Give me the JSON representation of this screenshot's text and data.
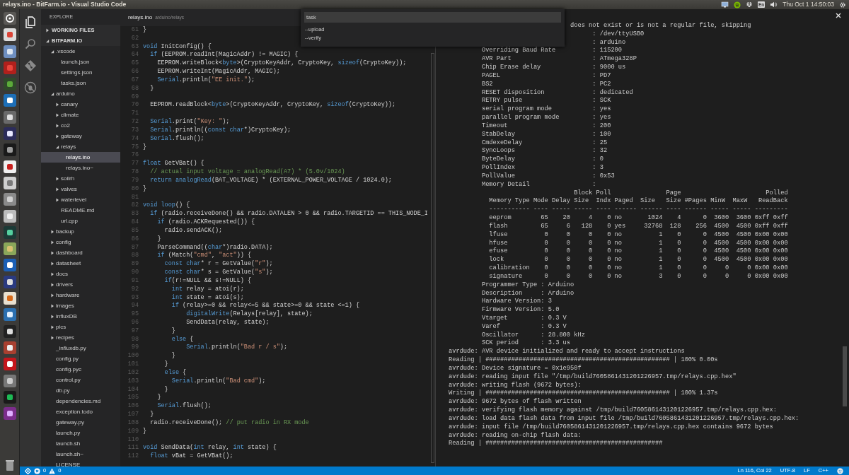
{
  "top_bar": {
    "title": "relays.ino - BitFarm.io - Visual Studio Code",
    "keyboard_layout": "En",
    "clock": "Thu Oct 1 14:50:03"
  },
  "activity_bar": [
    {
      "kind": "files",
      "selected": true
    },
    {
      "kind": "search",
      "selected": false
    },
    {
      "kind": "git",
      "selected": false
    },
    {
      "kind": "debug",
      "selected": false
    }
  ],
  "explorer": {
    "title": "EXPLORE",
    "sections": [
      {
        "label": "WORKING FILES",
        "expanded": false
      },
      {
        "label": "BITFARM.IO",
        "expanded": true,
        "children": [
          {
            "label": ".vscode",
            "kind": "folder",
            "expanded": true,
            "selected": false,
            "children": [
              {
                "label": "launch.json",
                "kind": "file",
                "selected": false
              },
              {
                "label": "settings.json",
                "kind": "file",
                "selected": false
              },
              {
                "label": "tasks.json",
                "kind": "file",
                "selected": false
              }
            ]
          },
          {
            "label": "arduino",
            "kind": "folder",
            "expanded": true,
            "selected": false,
            "children": [
              {
                "label": "canary",
                "kind": "folder",
                "expanded": false,
                "selected": false
              },
              {
                "label": "climate",
                "kind": "folder",
                "expanded": false,
                "selected": false
              },
              {
                "label": "co2",
                "kind": "folder",
                "expanded": false,
                "selected": false
              },
              {
                "label": "gateway",
                "kind": "folder",
                "expanded": false,
                "selected": false
              },
              {
                "label": "relays",
                "kind": "folder",
                "expanded": true,
                "selected": false,
                "children": [
                  {
                    "label": "relays.ino",
                    "kind": "file",
                    "selected": true
                  },
                  {
                    "label": "relays.ino~",
                    "kind": "file",
                    "selected": false
                  }
                ]
              },
              {
                "label": "soilrh",
                "kind": "folder",
                "expanded": false,
                "selected": false
              },
              {
                "label": "valves",
                "kind": "folder",
                "expanded": false,
                "selected": false
              },
              {
                "label": "waterlevel",
                "kind": "folder",
                "expanded": false,
                "selected": false
              },
              {
                "label": "README.md",
                "kind": "file",
                "selected": false
              },
              {
                "label": "url.cpp",
                "kind": "file",
                "selected": false
              }
            ]
          },
          {
            "label": "backup",
            "kind": "folder",
            "expanded": false,
            "selected": false
          },
          {
            "label": "config",
            "kind": "folder",
            "expanded": false,
            "selected": false
          },
          {
            "label": "dashboard",
            "kind": "folder",
            "expanded": false,
            "selected": false
          },
          {
            "label": "datasheet",
            "kind": "folder",
            "expanded": false,
            "selected": false
          },
          {
            "label": "docs",
            "kind": "folder",
            "expanded": false,
            "selected": false
          },
          {
            "label": "drivers",
            "kind": "folder",
            "expanded": false,
            "selected": false
          },
          {
            "label": "hardware",
            "kind": "folder",
            "expanded": false,
            "selected": false
          },
          {
            "label": "images",
            "kind": "folder",
            "expanded": false,
            "selected": false
          },
          {
            "label": "influxDB",
            "kind": "folder",
            "expanded": false,
            "selected": false
          },
          {
            "label": "pics",
            "kind": "folder",
            "expanded": false,
            "selected": false
          },
          {
            "label": "recipes",
            "kind": "folder",
            "expanded": false,
            "selected": false
          },
          {
            "label": "_influxdb.py",
            "kind": "file",
            "selected": false
          },
          {
            "label": "config.py",
            "kind": "file",
            "selected": false
          },
          {
            "label": "config.pyc",
            "kind": "file",
            "selected": false
          },
          {
            "label": "control.py",
            "kind": "file",
            "selected": false
          },
          {
            "label": "db.py",
            "kind": "file",
            "selected": false
          },
          {
            "label": "dependencies.md",
            "kind": "file",
            "selected": false
          },
          {
            "label": "exception.todo",
            "kind": "file",
            "selected": false
          },
          {
            "label": "gateway.py",
            "kind": "file",
            "selected": false
          },
          {
            "label": "launch.py",
            "kind": "file",
            "selected": false
          },
          {
            "label": "launch.sh",
            "kind": "file",
            "selected": false
          },
          {
            "label": "launch.sh~",
            "kind": "file",
            "selected": false
          },
          {
            "label": "LICENSE",
            "kind": "file",
            "selected": false
          }
        ]
      }
    ]
  },
  "editor": {
    "tab": {
      "file": "relays.ino",
      "path": "arduino/relays"
    },
    "lines": [
      {
        "n": "61",
        "code": [
          {
            "kind": "plain",
            "text": "}"
          }
        ]
      },
      {
        "n": "62"
      },
      {
        "n": "63",
        "code": [
          {
            "kind": "keyword",
            "text": "void"
          },
          {
            "kind": "plain",
            "text": " InitConfig() {"
          }
        ]
      },
      {
        "n": "64",
        "code": [
          {
            "kind": "keyword",
            "text": "  if"
          },
          {
            "kind": "plain",
            "text": " (EEPROM.readInt(MagicAddr) != MAGIC) {"
          }
        ]
      },
      {
        "n": "65",
        "code": [
          {
            "kind": "plain",
            "text": "    EEPROM.writeBlock<"
          },
          {
            "kind": "keyword",
            "text": "byte"
          },
          {
            "kind": "plain",
            "text": ">(CryptoKeyAddr, CryptoKey, "
          },
          {
            "kind": "keyword",
            "text": "sizeof"
          },
          {
            "kind": "plain",
            "text": "(CryptoKey));"
          }
        ]
      },
      {
        "n": "66",
        "code": [
          {
            "kind": "plain",
            "text": "    EEPROM.writeInt(MagicAddr, MAGIC);"
          }
        ]
      },
      {
        "n": "67",
        "code": [
          {
            "kind": "keyword",
            "text": "    Serial"
          },
          {
            "kind": "plain",
            "text": ".println("
          },
          {
            "kind": "string",
            "text": "\"EE init.\""
          },
          {
            "kind": "plain",
            "text": ");"
          }
        ]
      },
      {
        "n": "68",
        "code": [
          {
            "kind": "plain",
            "text": "  }"
          }
        ]
      },
      {
        "n": "69"
      },
      {
        "n": "70",
        "code": [
          {
            "kind": "plain",
            "text": "  EEPROM.readBlock<"
          },
          {
            "kind": "keyword",
            "text": "byte"
          },
          {
            "kind": "plain",
            "text": ">(CryptoKeyAddr, CryptoKey, "
          },
          {
            "kind": "keyword",
            "text": "sizeof"
          },
          {
            "kind": "plain",
            "text": "(CryptoKey));"
          }
        ]
      },
      {
        "n": "71"
      },
      {
        "n": "72",
        "code": [
          {
            "kind": "keyword",
            "text": "  Serial"
          },
          {
            "kind": "plain",
            "text": ".print("
          },
          {
            "kind": "string",
            "text": "\"Key: \""
          },
          {
            "kind": "plain",
            "text": ");"
          }
        ]
      },
      {
        "n": "73",
        "code": [
          {
            "kind": "keyword",
            "text": "  Serial"
          },
          {
            "kind": "plain",
            "text": ".println(("
          },
          {
            "kind": "keyword",
            "text": "const char"
          },
          {
            "kind": "plain",
            "text": "*)CryptoKey);"
          }
        ]
      },
      {
        "n": "74",
        "code": [
          {
            "kind": "keyword",
            "text": "  Serial"
          },
          {
            "kind": "plain",
            "text": ".flush();"
          }
        ]
      },
      {
        "n": "75",
        "code": [
          {
            "kind": "plain",
            "text": "}"
          }
        ]
      },
      {
        "n": "76"
      },
      {
        "n": "77",
        "code": [
          {
            "kind": "keyword",
            "text": "float"
          },
          {
            "kind": "plain",
            "text": " GetVBat() {"
          }
        ]
      },
      {
        "n": "78",
        "code": [
          {
            "kind": "comment",
            "text": "  // actual input voltage = analogRead(A7) * (5.0v/1024)"
          }
        ]
      },
      {
        "n": "79",
        "code": [
          {
            "kind": "keyword",
            "text": "  return analogRead"
          },
          {
            "kind": "plain",
            "text": "(BAT_VOLTAGE) * (EXTERNAL_POWER_VOLTAGE / 1024.0);"
          }
        ]
      },
      {
        "n": "80",
        "code": [
          {
            "kind": "plain",
            "text": "}"
          }
        ]
      },
      {
        "n": "81"
      },
      {
        "n": "82",
        "code": [
          {
            "kind": "keyword",
            "text": "void loop"
          },
          {
            "kind": "plain",
            "text": "() {"
          }
        ]
      },
      {
        "n": "83",
        "code": [
          {
            "kind": "keyword",
            "text": "  if"
          },
          {
            "kind": "plain",
            "text": " (radio.receiveDone() && radio.DATALEN > 0 && radio.TARGETID == THIS_NODE_I"
          }
        ]
      },
      {
        "n": "84",
        "code": [
          {
            "kind": "keyword",
            "text": "    if"
          },
          {
            "kind": "plain",
            "text": " (radio.ACKRequested()) {"
          }
        ]
      },
      {
        "n": "85",
        "code": [
          {
            "kind": "plain",
            "text": "      radio.sendACK();"
          }
        ]
      },
      {
        "n": "86",
        "code": [
          {
            "kind": "plain",
            "text": "    }"
          }
        ]
      },
      {
        "n": "87",
        "code": [
          {
            "kind": "plain",
            "text": "    ParseCommand(("
          },
          {
            "kind": "keyword",
            "text": "char"
          },
          {
            "kind": "plain",
            "text": "*)radio.DATA);"
          }
        ]
      },
      {
        "n": "88",
        "code": [
          {
            "kind": "keyword",
            "text": "    if"
          },
          {
            "kind": "plain",
            "text": " (Match("
          },
          {
            "kind": "string",
            "text": "\"cmd\""
          },
          {
            "kind": "plain",
            "text": ", "
          },
          {
            "kind": "string",
            "text": "\"act\""
          },
          {
            "kind": "plain",
            "text": ")) {"
          }
        ]
      },
      {
        "n": "89",
        "code": [
          {
            "kind": "keyword",
            "text": "      const char"
          },
          {
            "kind": "plain",
            "text": "* r = GetValue("
          },
          {
            "kind": "string",
            "text": "\"r\""
          },
          {
            "kind": "plain",
            "text": ");"
          }
        ]
      },
      {
        "n": "90",
        "code": [
          {
            "kind": "keyword",
            "text": "      const char"
          },
          {
            "kind": "plain",
            "text": "* s = GetValue("
          },
          {
            "kind": "string",
            "text": "\"s\""
          },
          {
            "kind": "plain",
            "text": ");"
          }
        ]
      },
      {
        "n": "91",
        "code": [
          {
            "kind": "keyword",
            "text": "      if"
          },
          {
            "kind": "plain",
            "text": "(r!=NULL && s!=NULL) {"
          }
        ]
      },
      {
        "n": "92",
        "code": [
          {
            "kind": "keyword",
            "text": "        int"
          },
          {
            "kind": "plain",
            "text": " relay = atoi(r);"
          }
        ]
      },
      {
        "n": "93",
        "code": [
          {
            "kind": "keyword",
            "text": "        int"
          },
          {
            "kind": "plain",
            "text": " state = atoi(s);"
          }
        ]
      },
      {
        "n": "94",
        "code": [
          {
            "kind": "keyword",
            "text": "        if"
          },
          {
            "kind": "plain",
            "text": " (relay>=0 && relay<=5 && state>=0 && state <=1) {"
          }
        ]
      },
      {
        "n": "95",
        "code": [
          {
            "kind": "keyword",
            "text": "            digitalWrite"
          },
          {
            "kind": "plain",
            "text": "(Relays[relay], state);"
          }
        ]
      },
      {
        "n": "96",
        "code": [
          {
            "kind": "plain",
            "text": "            SendData(relay, state);"
          }
        ]
      },
      {
        "n": "97",
        "code": [
          {
            "kind": "plain",
            "text": "        }"
          }
        ]
      },
      {
        "n": "98",
        "code": [
          {
            "kind": "keyword",
            "text": "        else"
          },
          {
            "kind": "plain",
            "text": " {"
          }
        ]
      },
      {
        "n": "99",
        "code": [
          {
            "kind": "keyword",
            "text": "            Serial"
          },
          {
            "kind": "plain",
            "text": ".println("
          },
          {
            "kind": "string",
            "text": "\"Bad r / s\""
          },
          {
            "kind": "plain",
            "text": ");"
          }
        ]
      },
      {
        "n": "100",
        "code": [
          {
            "kind": "plain",
            "text": "        }"
          }
        ]
      },
      {
        "n": "101",
        "code": [
          {
            "kind": "plain",
            "text": "      }"
          }
        ]
      },
      {
        "n": "102",
        "code": [
          {
            "kind": "keyword",
            "text": "      else"
          },
          {
            "kind": "plain",
            "text": " {"
          }
        ]
      },
      {
        "n": "103",
        "code": [
          {
            "kind": "keyword",
            "text": "        Serial"
          },
          {
            "kind": "plain",
            "text": ".println("
          },
          {
            "kind": "string",
            "text": "\"Bad cmd\""
          },
          {
            "kind": "plain",
            "text": ");"
          }
        ]
      },
      {
        "n": "104",
        "code": [
          {
            "kind": "plain",
            "text": "      }"
          }
        ]
      },
      {
        "n": "105",
        "code": [
          {
            "kind": "plain",
            "text": "    }"
          }
        ]
      },
      {
        "n": "106",
        "code": [
          {
            "kind": "keyword",
            "text": "    Serial"
          },
          {
            "kind": "plain",
            "text": ".flush();"
          }
        ]
      },
      {
        "n": "107",
        "code": [
          {
            "kind": "plain",
            "text": "  }"
          }
        ]
      },
      {
        "n": "108",
        "code": [
          {
            "kind": "plain",
            "text": "  radio.receiveDone(); "
          },
          {
            "kind": "comment",
            "text": "// put radio in RX mode"
          }
        ]
      },
      {
        "n": "109",
        "code": [
          {
            "kind": "plain",
            "text": "}"
          }
        ]
      },
      {
        "n": "110"
      },
      {
        "n": "111",
        "code": [
          {
            "kind": "keyword",
            "text": "void"
          },
          {
            "kind": "plain",
            "text": " SendData("
          },
          {
            "kind": "keyword",
            "text": "int"
          },
          {
            "kind": "plain",
            "text": " relay, "
          },
          {
            "kind": "keyword",
            "text": "int"
          },
          {
            "kind": "plain",
            "text": " state) {"
          }
        ]
      },
      {
        "n": "112",
        "code": [
          {
            "kind": "keyword",
            "text": "  float"
          },
          {
            "kind": "plain",
            "text": " vBat = GetVBat();"
          }
        ]
      }
    ]
  },
  "command_palette": {
    "value": "task",
    "items": [
      {
        "label": "--upload",
        "selected": false
      },
      {
        "label": "--verify",
        "selected": false
      }
    ]
  },
  "terminal": {
    "lines": [
      {
        "kind": "tail",
        "text": "does not exist or is not a regular file, skipping"
      },
      {
        "kind": "field",
        "value": ": /dev/ttyUSB0"
      },
      {
        "kind": "field",
        "value": ": arduino"
      },
      {
        "kind": "field",
        "label": "Overriding Baud Rate",
        "value": ": 115200"
      },
      {
        "kind": "field",
        "label": "AVR Part",
        "value": ": ATmega328P"
      },
      {
        "kind": "field",
        "label": "Chip Erase delay",
        "value": ": 9000 us"
      },
      {
        "kind": "field",
        "label": "PAGEL",
        "value": ": PD7"
      },
      {
        "kind": "field",
        "label": "BS2",
        "value": ": PC2"
      },
      {
        "kind": "field",
        "label": "RESET disposition",
        "value": ": dedicated"
      },
      {
        "kind": "field",
        "label": "RETRY pulse",
        "value": ": SCK"
      },
      {
        "kind": "field",
        "label": "serial program mode",
        "value": ": yes"
      },
      {
        "kind": "field",
        "label": "parallel program mode",
        "value": ": yes"
      },
      {
        "kind": "field",
        "label": "Timeout",
        "value": ": 200"
      },
      {
        "kind": "field",
        "label": "StabDelay",
        "value": ": 100"
      },
      {
        "kind": "field",
        "label": "CmdexeDelay",
        "value": ": 25"
      },
      {
        "kind": "field",
        "label": "SyncLoops",
        "value": ": 32"
      },
      {
        "kind": "field",
        "label": "ByteDelay",
        "value": ": 0"
      },
      {
        "kind": "field",
        "label": "PollIndex",
        "value": ": 3"
      },
      {
        "kind": "field",
        "label": "PollValue",
        "value": ": 0x53"
      },
      {
        "kind": "field",
        "label": "Memory Detail",
        "value": ":"
      },
      {
        "kind": "log",
        "text": "                                  Block Poll               Page                       Polled"
      },
      {
        "kind": "log",
        "text": "           Memory Type Mode Delay Size  Indx Paged  Size   Size #Pages MinW  MaxW   ReadBack"
      },
      {
        "kind": "log",
        "text": "           ----------- ---- ----- ----- ---- ------ ------ ---- ------ ----- ----- ---------"
      },
      {
        "kind": "mem",
        "cells": [
          "eeprom",
          "65",
          "20",
          "4",
          "0",
          "no",
          "1024",
          "4",
          "0",
          "3600",
          "3600",
          "0xff",
          "0xff"
        ]
      },
      {
        "kind": "mem",
        "cells": [
          "flash",
          "65",
          "6",
          "128",
          "0",
          "yes",
          "32768",
          "128",
          "256",
          "4500",
          "4500",
          "0xff",
          "0xff"
        ]
      },
      {
        "kind": "mem",
        "cells": [
          "lfuse",
          "0",
          "0",
          "0",
          "0",
          "no",
          "1",
          "0",
          "0",
          "4500",
          "4500",
          "0x00",
          "0x00"
        ]
      },
      {
        "kind": "mem",
        "cells": [
          "hfuse",
          "0",
          "0",
          "0",
          "0",
          "no",
          "1",
          "0",
          "0",
          "4500",
          "4500",
          "0x00",
          "0x00"
        ]
      },
      {
        "kind": "mem",
        "cells": [
          "efuse",
          "0",
          "0",
          "0",
          "0",
          "no",
          "1",
          "0",
          "0",
          "4500",
          "4500",
          "0x00",
          "0x00"
        ]
      },
      {
        "kind": "mem",
        "cells": [
          "lock",
          "0",
          "0",
          "0",
          "0",
          "no",
          "1",
          "0",
          "0",
          "4500",
          "4500",
          "0x00",
          "0x00"
        ]
      },
      {
        "kind": "mem",
        "cells": [
          "calibration",
          "0",
          "0",
          "0",
          "0",
          "no",
          "1",
          "0",
          "0",
          "0",
          "0",
          "0x00",
          "0x00"
        ]
      },
      {
        "kind": "mem",
        "cells": [
          "signature",
          "0",
          "0",
          "0",
          "0",
          "no",
          "3",
          "0",
          "0",
          "0",
          "0",
          "0x00",
          "0x00"
        ]
      },
      {
        "kind": "info",
        "label": "Programmer Type",
        "value": ": Arduino"
      },
      {
        "kind": "info",
        "label": "Description",
        "value": ": Arduino"
      },
      {
        "kind": "info",
        "label": "Hardware Version",
        "value": ": 3"
      },
      {
        "kind": "info",
        "label": "Firmware Version",
        "value": ": 5.0"
      },
      {
        "kind": "info",
        "label": "Vtarget",
        "value": ": 0.3 V"
      },
      {
        "kind": "info",
        "label": "Varef",
        "value": ": 0.3 V"
      },
      {
        "kind": "info",
        "label": "Oscillator",
        "value": ": 28.800 kHz"
      },
      {
        "kind": "info",
        "label": "SCK period",
        "value": ": 3.3 us"
      },
      {
        "kind": "log",
        "text": "avrdude: AVR device initialized and ready to accept instructions"
      },
      {
        "kind": "log",
        "text": "Reading | ################################################## | 100% 0.00s"
      },
      {
        "kind": "log",
        "text": "avrdude: Device signature = 0x1e950f"
      },
      {
        "kind": "log",
        "text": "avrdude: reading input file \"/tmp/build7605861431201226957.tmp/relays.cpp.hex\""
      },
      {
        "kind": "log",
        "text": "avrdude: writing flash (9672 bytes):"
      },
      {
        "kind": "log",
        "text": "Writing | ################################################## | 100% 1.37s"
      },
      {
        "kind": "log",
        "text": "avrdude: 9672 bytes of flash written"
      },
      {
        "kind": "log",
        "text": "avrdude: verifying flash memory against /tmp/build7605861431201226957.tmp/relays.cpp.hex:"
      },
      {
        "kind": "log",
        "text": "avrdude: load data flash data from input file /tmp/build7605861431201226957.tmp/relays.cpp.hex:"
      },
      {
        "kind": "log",
        "text": "avrdude: input file /tmp/build7605861431201226957.tmp/relays.cpp.hex contains 9672 bytes"
      },
      {
        "kind": "log",
        "text": "avrdude: reading on-chip flash data:"
      },
      {
        "kind": "log",
        "text": "Reading | ################################################"
      }
    ]
  },
  "status_bar": {
    "errors": "0",
    "warnings": "0",
    "position": "Ln 116, Col 22",
    "encoding": "UTF-8",
    "line_ending": "LF",
    "language": "C++"
  }
}
